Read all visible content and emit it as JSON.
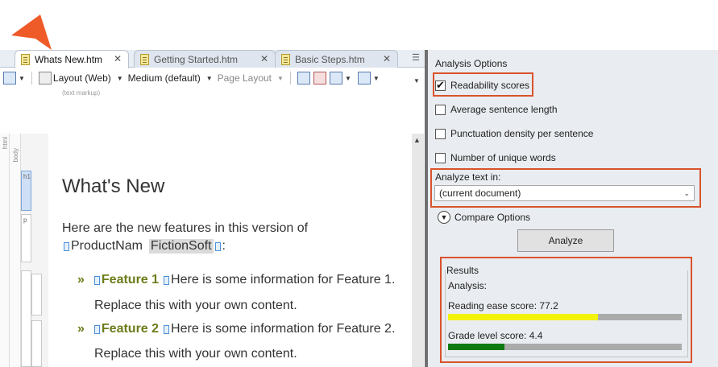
{
  "tabs": [
    {
      "label": "Whats New.htm",
      "active": true
    },
    {
      "label": "Getting Started.htm",
      "active": false
    },
    {
      "label": "Basic Steps.htm",
      "active": false
    }
  ],
  "tab_close_glyph": "✕",
  "toolbar": {
    "layout_label": "Layout (Web)",
    "medium_label": "Medium (default)",
    "page_layout_label": "Page Layout"
  },
  "text_markup_label": "(text markup)",
  "structure": {
    "html_label": "html",
    "body_label": "body",
    "h1_label": "h1",
    "p_label": "p"
  },
  "document": {
    "heading": "What's New",
    "intro": "Here are the new features in this version of",
    "variable_name": "ProductNam",
    "variable_value": "FictionSoft",
    "variable_suffix": ":",
    "features": [
      {
        "name": "Feature 1",
        "text": "Here is some information for Feature 1.",
        "line2": "Replace this with your own content."
      },
      {
        "name": "Feature 2",
        "text": "Here is some information for Feature 2.",
        "line2": "Replace this with your own content."
      }
    ],
    "bullet_glyph": "»"
  },
  "analysis": {
    "title": "Analysis Options",
    "options": [
      {
        "label": "Readability scores",
        "checked": true
      },
      {
        "label": "Average sentence length",
        "checked": false
      },
      {
        "label": "Punctuation density per sentence",
        "checked": false
      },
      {
        "label": "Number of unique words",
        "checked": false
      }
    ],
    "analyze_text_label": "Analyze text in:",
    "analyze_text_value": "(current document)",
    "compare_label": "Compare Options",
    "analyze_button": "Analyze",
    "results_title": "Results",
    "analysis_label": "Analysis:",
    "reading_ease_label": "Reading ease score: 77.2",
    "reading_ease_fill": 0.642,
    "grade_level_label": "Grade level score: 4.4",
    "grade_level_fill": 0.242
  },
  "colors": {
    "highlight": "#d9532c",
    "reading_bar": "#f2f20a",
    "grade_bar": "#0f7a0f",
    "feature_text": "#6a7d1a",
    "pointer": "#ef5a29"
  }
}
